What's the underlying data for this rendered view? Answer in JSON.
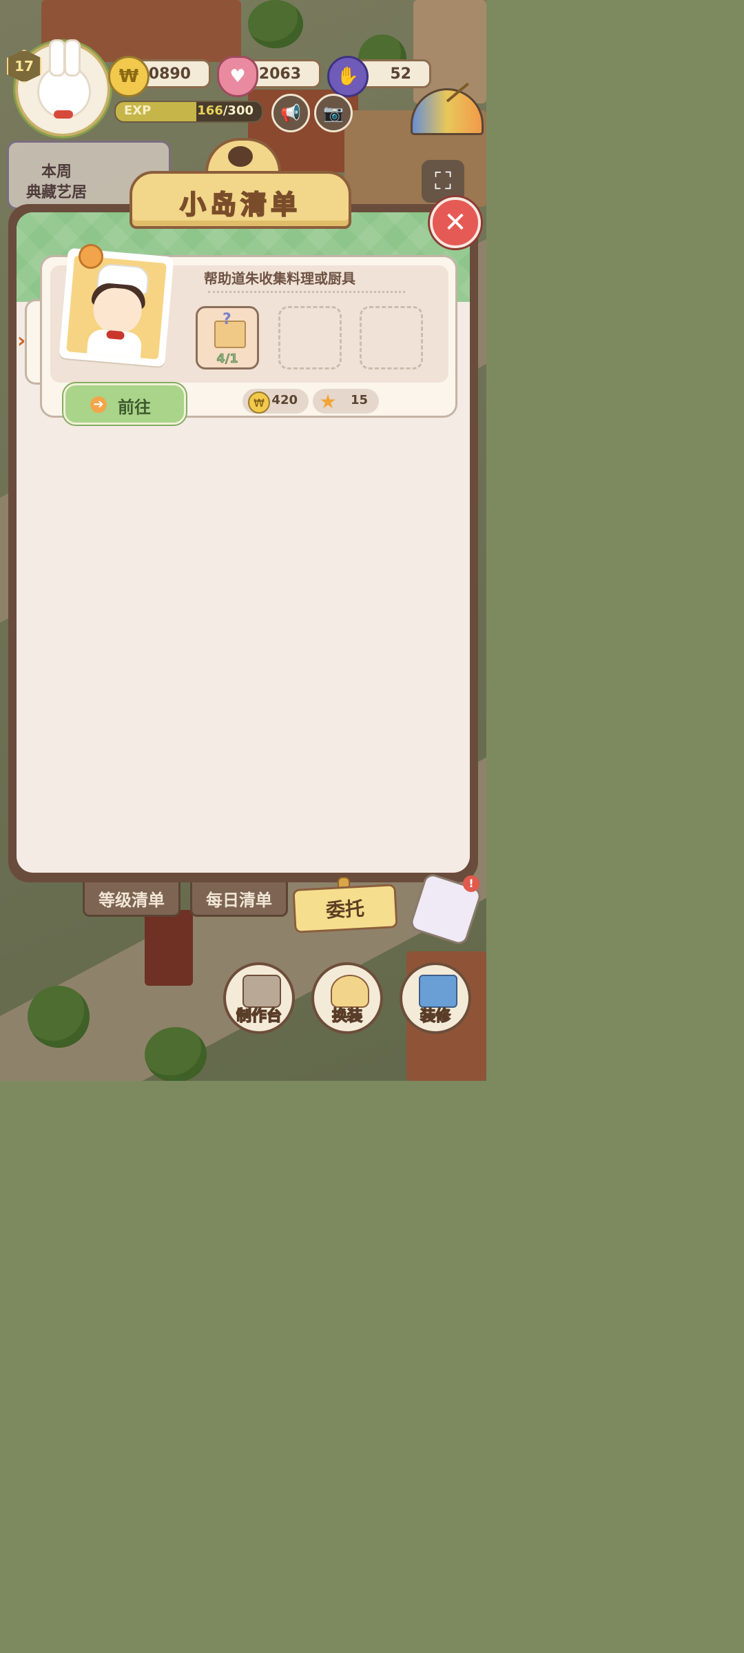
{
  "hud": {
    "level": "17",
    "coins": "10890",
    "hearts": "2063",
    "gloves": "52",
    "exp_label": "EXP",
    "exp_current": "166",
    "exp_max": "/300",
    "exp_progress": 0.553,
    "week_label": "本周\n典藏艺居",
    "week_line1": "本周",
    "week_line2": "典藏艺居"
  },
  "panel": {
    "title": "小岛清单",
    "task": {
      "description": "帮助道朱收集料理或厨具",
      "item_count": "4/1",
      "go_label": "前往",
      "rewards": [
        {
          "icon": "coin-icon",
          "value": "420"
        },
        {
          "icon": "star-icon",
          "value": "15"
        }
      ]
    }
  },
  "tabs": {
    "level_list": "等级清单",
    "daily_list": "每日清单",
    "commission": "委托"
  },
  "bottom": {
    "craft": "制作台",
    "dress": "换装",
    "decorate": "装修"
  },
  "colors": {
    "panel_frame": "#6a4c3c",
    "go_button": "#a9d489",
    "close_button": "#e55a55"
  }
}
